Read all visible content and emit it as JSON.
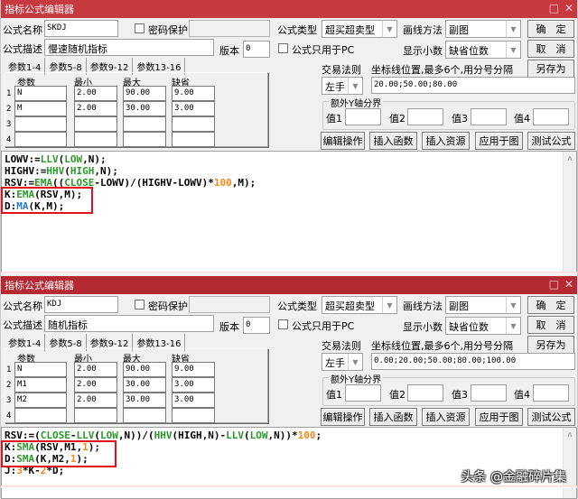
{
  "dialogs": [
    {
      "title": "指标公式编辑器",
      "formula_name_label": "公式名称",
      "formula_name": "SKDJ",
      "password_label": "密码保护",
      "password_checked": false,
      "password_value": "",
      "formula_desc_label": "公式描述",
      "formula_desc": "慢速随机指标",
      "version_label": "版本",
      "version": "0",
      "formula_type_label": "公式类型",
      "formula_type": "超买超卖型",
      "draw_method_label": "画线方法",
      "draw_method": "副图",
      "pc_only_label": "公式只用于PC",
      "pc_only_checked": false,
      "decimals_label": "显示小数",
      "decimals": "缺省位数",
      "ok_label": "确　定",
      "cancel_label": "取　消",
      "save_as_label": "另存为",
      "trade_rule_label": "交易法则",
      "trade_rule": "左手",
      "axis_label": "坐标线位置,最多6个,用分号分隔",
      "axis_value": "20.00;50.00;80.00",
      "extra_y_label": "额外Y轴分界",
      "extra_values": [
        {
          "label": "值1",
          "value": ""
        },
        {
          "label": "值2",
          "value": ""
        },
        {
          "label": "值3",
          "value": ""
        },
        {
          "label": "值4",
          "value": ""
        }
      ],
      "buttons": [
        "编辑操作",
        "插入函数",
        "插入资源",
        "应用于图",
        "测试公式"
      ],
      "tabs": [
        "参数1-4",
        "参数5-8",
        "参数9-12",
        "参数13-16"
      ],
      "param_headers": [
        "参数",
        "最小",
        "最大",
        "缺省"
      ],
      "params": [
        {
          "row": "1",
          "name": "N",
          "min": "2.00",
          "max": "90.00",
          "default": "9.00"
        },
        {
          "row": "2",
          "name": "M",
          "min": "2.00",
          "max": "30.00",
          "default": "3.00"
        },
        {
          "row": "3",
          "name": "",
          "min": "",
          "max": "",
          "default": ""
        },
        {
          "row": "4",
          "name": "",
          "min": "",
          "max": "",
          "default": ""
        }
      ],
      "code": [
        [
          {
            "t": "LOWV:=",
            "c": "op"
          },
          {
            "t": "LLV",
            "c": "fn"
          },
          {
            "t": "(",
            "c": "op"
          },
          {
            "t": "LOW",
            "c": "fn"
          },
          {
            "t": ",N);",
            "c": "op"
          }
        ],
        [
          {
            "t": "HIGHV:=",
            "c": "op"
          },
          {
            "t": "HHV",
            "c": "fn"
          },
          {
            "t": "(",
            "c": "op"
          },
          {
            "t": "HIGH",
            "c": "fn"
          },
          {
            "t": ",N);",
            "c": "op"
          }
        ],
        [
          {
            "t": "RSV:=",
            "c": "op"
          },
          {
            "t": "EMA",
            "c": "fn"
          },
          {
            "t": "((",
            "c": "op"
          },
          {
            "t": "CLOSE",
            "c": "fn"
          },
          {
            "t": "-LOWV)/(HIGHV-LOWV)*",
            "c": "op"
          },
          {
            "t": "100",
            "c": "num"
          },
          {
            "t": ",M);",
            "c": "op"
          }
        ],
        [
          {
            "t": "K:",
            "c": "op"
          },
          {
            "t": "EMA",
            "c": "fn"
          },
          {
            "t": "(RSV,M);",
            "c": "op"
          }
        ],
        [
          {
            "t": "D:",
            "c": "op"
          },
          {
            "t": "MA",
            "c": "blue"
          },
          {
            "t": "(K,M);",
            "c": "op"
          }
        ]
      ]
    },
    {
      "title": "指标公式编辑器",
      "formula_name_label": "公式名称",
      "formula_name": "KDJ",
      "password_label": "密码保护",
      "password_checked": false,
      "password_value": "",
      "formula_desc_label": "公式描述",
      "formula_desc": "随机指标",
      "version_label": "版本",
      "version": "0",
      "formula_type_label": "公式类型",
      "formula_type": "超买超卖型",
      "draw_method_label": "画线方法",
      "draw_method": "副图",
      "pc_only_label": "公式只用于PC",
      "pc_only_checked": false,
      "decimals_label": "显示小数",
      "decimals": "缺省位数",
      "ok_label": "确　定",
      "cancel_label": "取　消",
      "save_as_label": "另存为",
      "trade_rule_label": "交易法则",
      "trade_rule": "左手",
      "axis_label": "坐标线位置,最多6个,用分号分隔",
      "axis_value": "0.00;20.00;50.00;80.00;100.00",
      "extra_y_label": "额外Y轴分界",
      "extra_values": [
        {
          "label": "值1",
          "value": ""
        },
        {
          "label": "值2",
          "value": ""
        },
        {
          "label": "值3",
          "value": ""
        },
        {
          "label": "值4",
          "value": ""
        }
      ],
      "buttons": [
        "编辑操作",
        "插入函数",
        "插入资源",
        "应用于图",
        "测试公式"
      ],
      "tabs": [
        "参数1-4",
        "参数5-8",
        "参数9-12",
        "参数13-16"
      ],
      "param_headers": [
        "参数",
        "最小",
        "最大",
        "缺省"
      ],
      "params": [
        {
          "row": "1",
          "name": "N",
          "min": "2.00",
          "max": "90.00",
          "default": "9.00"
        },
        {
          "row": "2",
          "name": "M1",
          "min": "2.00",
          "max": "30.00",
          "default": "3.00"
        },
        {
          "row": "3",
          "name": "M2",
          "min": "2.00",
          "max": "30.00",
          "default": "3.00"
        },
        {
          "row": "4",
          "name": "",
          "min": "",
          "max": "",
          "default": ""
        }
      ],
      "code": [
        [
          {
            "t": "RSV:=(",
            "c": "op"
          },
          {
            "t": "CLOSE",
            "c": "fn"
          },
          {
            "t": "-",
            "c": "op"
          },
          {
            "t": "LLV",
            "c": "fn"
          },
          {
            "t": "(",
            "c": "op"
          },
          {
            "t": "LOW",
            "c": "fn"
          },
          {
            "t": ",N))/(",
            "c": "op"
          },
          {
            "t": "HHV",
            "c": "fn"
          },
          {
            "t": "(HIGH,N)-",
            "c": "op"
          },
          {
            "t": "LLV",
            "c": "fn"
          },
          {
            "t": "(",
            "c": "op"
          },
          {
            "t": "LOW",
            "c": "fn"
          },
          {
            "t": ",N))*",
            "c": "op"
          },
          {
            "t": "100",
            "c": "num"
          },
          {
            "t": ";",
            "c": "op"
          }
        ],
        [
          {
            "t": "K:",
            "c": "op"
          },
          {
            "t": "SMA",
            "c": "fn"
          },
          {
            "t": "(RSV,M1,",
            "c": "op"
          },
          {
            "t": "1",
            "c": "num"
          },
          {
            "t": ");",
            "c": "op"
          }
        ],
        [
          {
            "t": "D:",
            "c": "op"
          },
          {
            "t": "SMA",
            "c": "fn"
          },
          {
            "t": "(K,M2,",
            "c": "op"
          },
          {
            "t": "1",
            "c": "num"
          },
          {
            "t": ");",
            "c": "op"
          }
        ],
        [
          {
            "t": "J:",
            "c": "op"
          },
          {
            "t": "3",
            "c": "num"
          },
          {
            "t": "*K-",
            "c": "op"
          },
          {
            "t": "2",
            "c": "num"
          },
          {
            "t": "*D;",
            "c": "op"
          }
        ]
      ]
    }
  ],
  "watermark": "头条 @金融碎片集",
  "colors": {
    "titlebar": "#c8383f",
    "highlight_box": "#e3101e",
    "function": "#2a9a2a",
    "number": "#f58a1a",
    "ma_function": "#2a7ad0"
  }
}
